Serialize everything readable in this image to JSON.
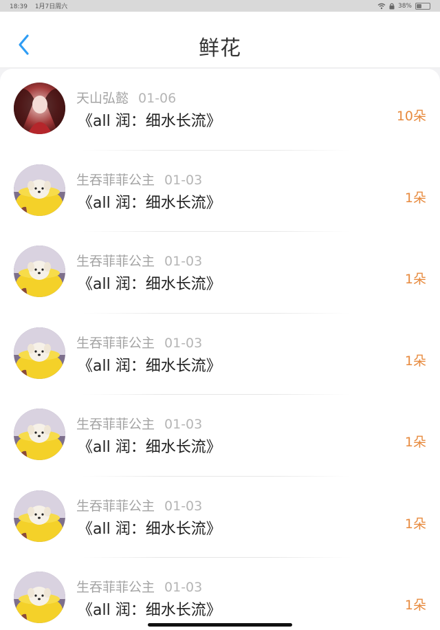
{
  "status_bar": {
    "time": "18:39",
    "date": "1月7日周六",
    "battery": "38%",
    "battery_level": 0.38
  },
  "header": {
    "title": "鲜花",
    "back_icon": "chevron-left-icon",
    "accent_color": "#2f9df4"
  },
  "records": [
    {
      "user": "天山弘懿",
      "date": "01-06",
      "work": "《all 润：细水长流》",
      "flowers": "10朵",
      "avatar": "anime-avatar"
    },
    {
      "user": "生吞菲菲公主",
      "date": "01-03",
      "work": "《all 润：细水长流》",
      "flowers": "1朵",
      "avatar": "puppy-avatar"
    },
    {
      "user": "生吞菲菲公主",
      "date": "01-03",
      "work": "《all 润：细水长流》",
      "flowers": "1朵",
      "avatar": "puppy-avatar"
    },
    {
      "user": "生吞菲菲公主",
      "date": "01-03",
      "work": "《all 润：细水长流》",
      "flowers": "1朵",
      "avatar": "puppy-avatar"
    },
    {
      "user": "生吞菲菲公主",
      "date": "01-03",
      "work": "《all 润：细水长流》",
      "flowers": "1朵",
      "avatar": "puppy-avatar"
    },
    {
      "user": "生吞菲菲公主",
      "date": "01-03",
      "work": "《all 润：细水长流》",
      "flowers": "1朵",
      "avatar": "puppy-avatar"
    },
    {
      "user": "生吞菲菲公主",
      "date": "01-03",
      "work": "《all 润：细水长流》",
      "flowers": "1朵",
      "avatar": "puppy-avatar"
    }
  ],
  "colors": {
    "flower_count": "#e78a3e",
    "username": "#a3a3a3",
    "title_text": "#222222"
  }
}
